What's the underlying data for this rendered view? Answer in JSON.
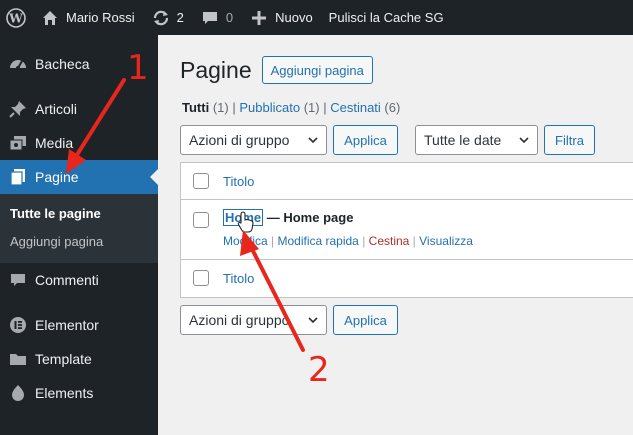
{
  "adminbar": {
    "user": "Mario Rossi",
    "updates_count": "2",
    "comments_count": "0",
    "new_label": "Nuovo",
    "cache_label": "Pulisci la Cache SG"
  },
  "sidebar": {
    "items": [
      {
        "label": "Bacheca",
        "icon": "dashboard-icon"
      },
      {
        "label": "Articoli",
        "icon": "pin-icon"
      },
      {
        "label": "Media",
        "icon": "media-icon"
      },
      {
        "label": "Pagine",
        "icon": "pages-icon"
      },
      {
        "label": "Commenti",
        "icon": "comments-icon"
      },
      {
        "label": "Elementor",
        "icon": "elementor-icon"
      },
      {
        "label": "Template",
        "icon": "folder-icon"
      },
      {
        "label": "Elements",
        "icon": "elements-icon"
      }
    ],
    "submenu": [
      "Tutte le pagine",
      "Aggiungi pagina"
    ]
  },
  "main": {
    "title": "Pagine",
    "add_button": "Aggiungi pagina",
    "views": {
      "all": "Tutti",
      "all_count": "(1)",
      "published": "Pubblicato",
      "published_count": "(1)",
      "trash": "Cestinati",
      "trash_count": "(6)",
      "sep": "|"
    },
    "bulk_select": "Azioni di gruppo",
    "apply": "Applica",
    "date_select": "Tutte le date",
    "filter": "Filtra",
    "col_title": "Titolo",
    "row": {
      "title_link": "Home",
      "title_suffix": " — Home page",
      "actions": [
        "Modifica",
        "Modifica rapida",
        "Cestina",
        "Visualizza"
      ],
      "sep": " | "
    }
  },
  "annotations": {
    "one": "1",
    "two": "2"
  },
  "colors": {
    "adminbar": "#1d2327",
    "accent": "#2271b1",
    "background": "#f0f0f1",
    "arrow": "#e8261c",
    "trash": "#b32d2e"
  }
}
